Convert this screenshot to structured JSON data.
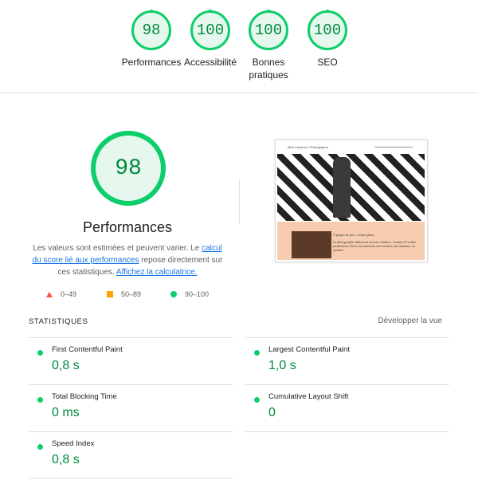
{
  "categories": [
    {
      "score": "98",
      "label": "Performances"
    },
    {
      "score": "100",
      "label": "Accessibilité"
    },
    {
      "score": "100",
      "label": "Bonnes pratiques"
    },
    {
      "score": "100",
      "label": "SEO"
    }
  ],
  "main": {
    "score": "98",
    "title": "Performances",
    "desc_1": "Les valeurs sont estimées et peuvent varier. Le ",
    "desc_link_1": "calcul du score lié aux performances",
    "desc_2": " repose directement sur ces statistiques. ",
    "desc_link_2": "Affichez la calculatrice.",
    "legend": [
      {
        "range": "0–49",
        "color": "#ff4e42",
        "shape": "triangle"
      },
      {
        "range": "50–89",
        "color": "#ffa400",
        "shape": "square"
      },
      {
        "range": "90–100",
        "color": "#0cce6b",
        "shape": "circle"
      }
    ]
  },
  "screenshot": {
    "site_title": "Mira Carducci / Photographe",
    "heading": "À propos de moi – Artiste photo",
    "paragraph": "La photographie dada pour moi une évidence. Comme il l’a dans productions; Suivre ma manoeuv, une émotion, une situation, un moment..."
  },
  "stats": {
    "title": "STATISTIQUES",
    "expand_label": "Développer la vue",
    "metrics": [
      {
        "name": "First Contentful Paint",
        "value": "0,8 s"
      },
      {
        "name": "Largest Contentful Paint",
        "value": "1,0 s"
      },
      {
        "name": "Total Blocking Time",
        "value": "0 ms"
      },
      {
        "name": "Cumulative Layout Shift",
        "value": "0"
      },
      {
        "name": "Speed Index",
        "value": "0,8 s"
      }
    ]
  },
  "colors": {
    "pass": "#0cce6b",
    "pass_text": "#008a3e",
    "link": "#1a73e8"
  }
}
